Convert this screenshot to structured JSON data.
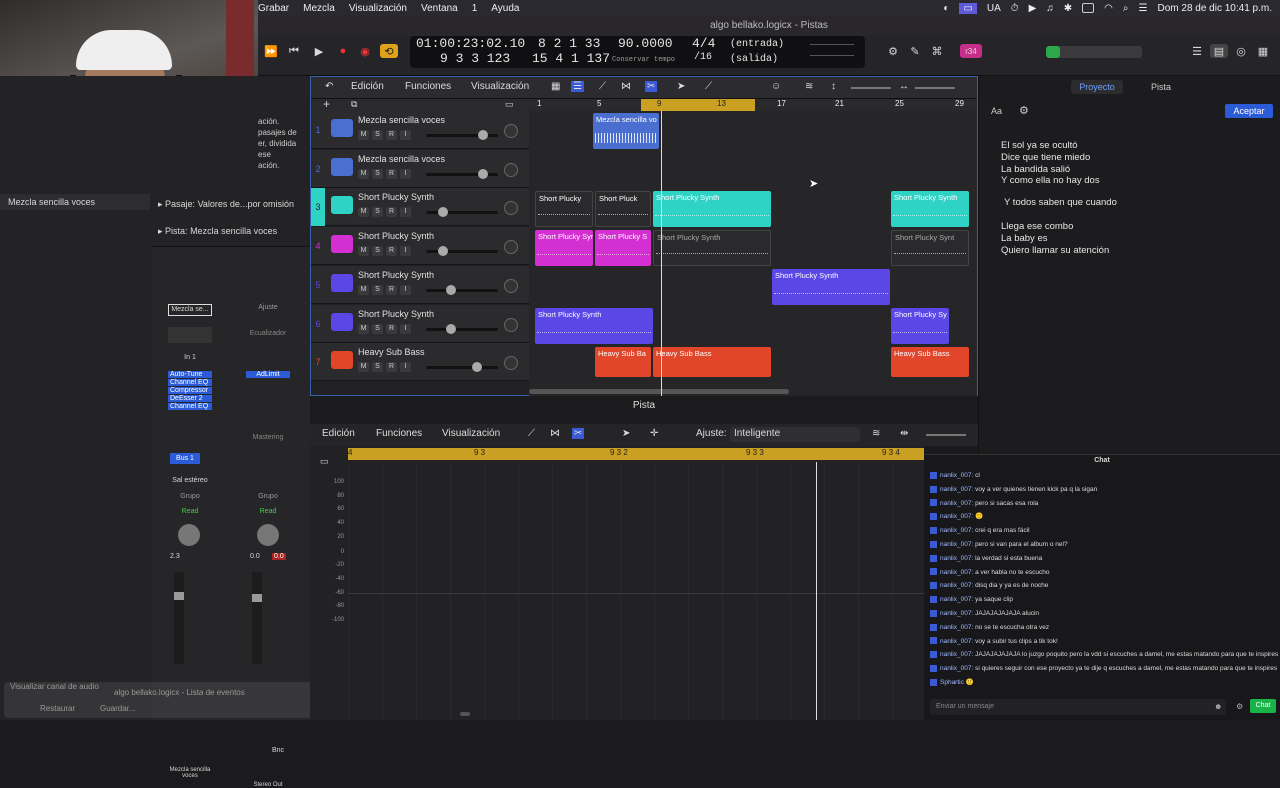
{
  "menubar": {
    "items": [
      "Grabar",
      "Mezcla",
      "Visualización",
      "Ventana",
      "1",
      "Ayuda"
    ],
    "right": [
      "UA",
      "Dom 28 de dic  10:41 p.m."
    ]
  },
  "window": {
    "title": "algo bellako.logicx - Pistas"
  },
  "transport": {
    "position_time": "01:00:23:02.10",
    "position_bars": "8  2  1    33",
    "position_bars2": "9  3  3  123",
    "position_bars3": "15  4  1  137",
    "tempo": "90.0000",
    "tempo_label": "Conservar tempo",
    "signature": "4/4",
    "division": "/16",
    "in": "(entrada)",
    "out": "(salida)",
    "badge": "r34"
  },
  "inspector": {
    "text_lines": [
      "ación.",
      "pasajes de",
      "er, dividida",
      "ese",
      "ación."
    ],
    "region_name": "Mezcla sencilla voces",
    "pasaje_label": "Pasaje:",
    "pasaje_value": "Valores de...por omisión",
    "pista_label": "Pista:",
    "pista_value": "Mezcla sencilla voces",
    "strip1": {
      "name": "Mezcla se...",
      "input": "In 1",
      "plugins": [
        "Auto-Tune",
        "Channel EQ",
        "Compressor",
        "DeEsser 2",
        "Channel EQ"
      ],
      "bus": "Bus 1",
      "output": "Sal estéreo",
      "group": "Grupo",
      "auto": "Read",
      "value": "2.3",
      "bottom": "Mezcla sencilla voces"
    },
    "strip2": {
      "name": "Ajuste",
      "eq": "Ecualizador",
      "plugin": "AdLimit",
      "mastering": "Mastering",
      "group": "Grupo",
      "auto": "Read",
      "value_a": "0.0",
      "value_b": "0.0",
      "bnc": "Bnc",
      "bottom": "Stereo Out"
    },
    "ghost": [
      "Visualizar canal de audio",
      "algo bellako.logicx - Lista de eventos",
      "Restaurar",
      "Guardar..."
    ]
  },
  "tracks_toolbar": {
    "edicion": "Edición",
    "funciones": "Funciones",
    "visualizacion": "Visualización"
  },
  "ruler": [
    "1",
    "5",
    "9",
    "13",
    "17",
    "21",
    "25",
    "29"
  ],
  "tracks": [
    {
      "num": "1",
      "name": "Mezcla sencilla voces",
      "color": "#4a6fd1"
    },
    {
      "num": "2",
      "name": "Mezcla sencilla voces",
      "color": "#4a6fd1"
    },
    {
      "num": "3",
      "name": "Short Plucky Synth",
      "color": "#2fd3c5"
    },
    {
      "num": "4",
      "name": "Short Plucky Synth",
      "color": "#d42fd0"
    },
    {
      "num": "5",
      "name": "Short Plucky Synth",
      "color": "#5b47e6"
    },
    {
      "num": "6",
      "name": "Short Plucky Synth",
      "color": "#5b47e6"
    },
    {
      "num": "7",
      "name": "Heavy Sub Bass",
      "color": "#e2462a"
    }
  ],
  "regions": {
    "r1": "Mezcla sencilla vo",
    "r3a": "Short Plucky",
    "r3b": "Short Pluck",
    "r3c": "Short Plucky Synth",
    "r3d": "Short Plucky Synth",
    "r4a": "Short Plucky Syn",
    "r4b": "Short Plucky S",
    "r4c": "Short Plucky Synth",
    "r4d": "Short Plucky Synt",
    "r5a": "Short Plucky Synth",
    "r6a": "Short Plucky Synth",
    "r6b": "Short Plucky Sy",
    "r7a": "Heavy Sub Ba",
    "r7b": "Heavy Sub Bass",
    "r7c": "Heavy Sub Bass"
  },
  "lyrics": {
    "tab_proyecto": "Proyecto",
    "tab_pista": "Pista",
    "aa": "Aa",
    "accept": "Aceptar",
    "lines": [
      "El sol ya se ocultó",
      "Dice que tiene miedo",
      "La bandida salió",
      "Y como ella no hay dos",
      "",
      "Y todos saben que cuando",
      "",
      "Llega ese combo",
      "La baby es",
      "Quiero llamar su atención"
    ]
  },
  "editor": {
    "title": "Pista",
    "edicion": "Edición",
    "funciones": "Funciones",
    "visualizacion": "Visualización",
    "ajuste_label": "Ajuste:",
    "ajuste_value": "Inteligente",
    "ruler": [
      "4",
      "9 3",
      "9 3 2",
      "9 3 3",
      "9 3 4"
    ],
    "yaxis": [
      "100",
      "80",
      "60",
      "40",
      "20",
      "0",
      "-20",
      "-40",
      "-60",
      "-80",
      "-100"
    ]
  },
  "chat": {
    "title": "Chat",
    "messages": [
      {
        "user": "nanlix_007:",
        "text": "cl"
      },
      {
        "user": "nanlix_007:",
        "text": "voy a ver quienes tienen kick pa q la sigan"
      },
      {
        "user": "nanlix_007:",
        "text": "pero si sacas esa rola"
      },
      {
        "user": "nanlix_007:",
        "text": "🙂"
      },
      {
        "user": "nanlix_007:",
        "text": "crei q era mas fácil"
      },
      {
        "user": "nanlix_007:",
        "text": "pero si van para el album o nel?"
      },
      {
        "user": "nanlix_007:",
        "text": "la verdad si esta buena"
      },
      {
        "user": "nanlix_007:",
        "text": "a ver habla no te escucho"
      },
      {
        "user": "nanlix_007:",
        "text": "disq dia y ya es de noche"
      },
      {
        "user": "nanlix_007:",
        "text": "ya saque clip"
      },
      {
        "user": "nanlix_007:",
        "text": "JAJAJAJAJAJA alucin"
      },
      {
        "user": "nanlix_007:",
        "text": "no se te escucha otra vez"
      },
      {
        "user": "nanlix_007:",
        "text": "voy a subir tus clips a tik tok!"
      },
      {
        "user": "nanlix_007:",
        "text": "JAJAJAJAJAJA lo juzgo poquito pero la vdd si escuches a damel, me estas matando para que te inspires"
      },
      {
        "user": "nanlix_007:",
        "text": "si quieres seguir con ese proyecto ya te dije q escuches a damel, me estas matando para que te inspires"
      },
      {
        "user": "Sphartic",
        "text": "🙂"
      }
    ],
    "placeholder": "Enviar un mensaje",
    "send": "Chat"
  }
}
